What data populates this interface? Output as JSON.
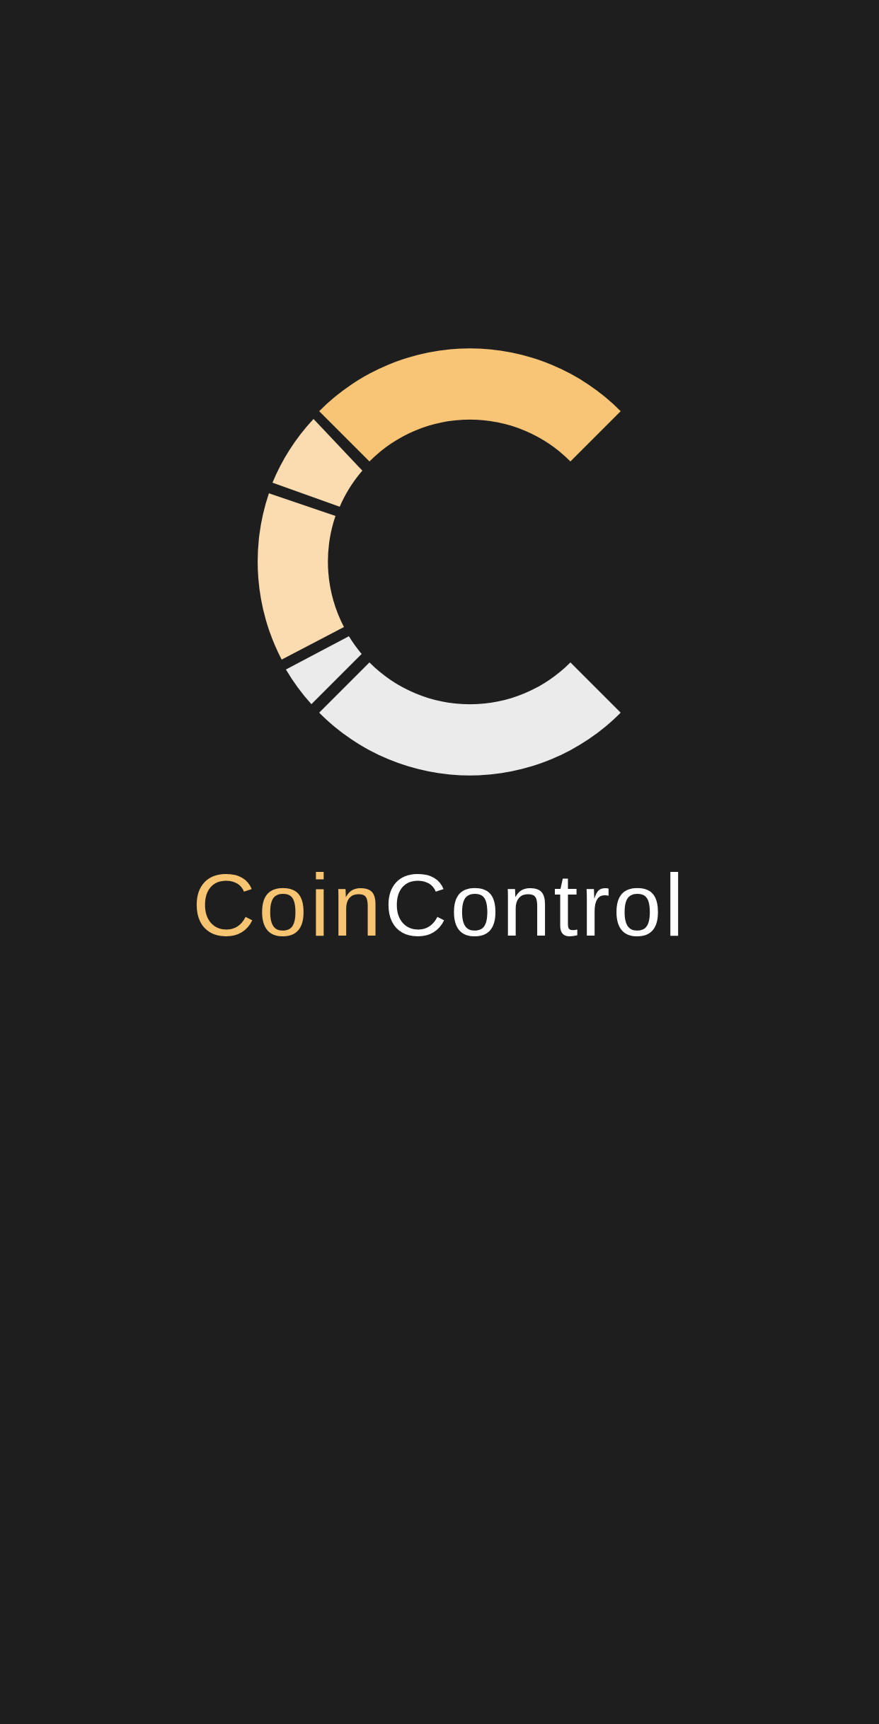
{
  "app": {
    "name_part_1": "Coin",
    "name_part_2": "Control"
  },
  "logo": {
    "icon": "coincontrol-logo-icon",
    "colors": {
      "top_segment": "#f8c576",
      "upper_left_segments": "#fadcb0",
      "lower_segments": "#ebebeb"
    }
  },
  "colors": {
    "background": "#1e1e1e",
    "wordmark_accent": "#f7c472",
    "wordmark_primary": "#ffffff"
  }
}
